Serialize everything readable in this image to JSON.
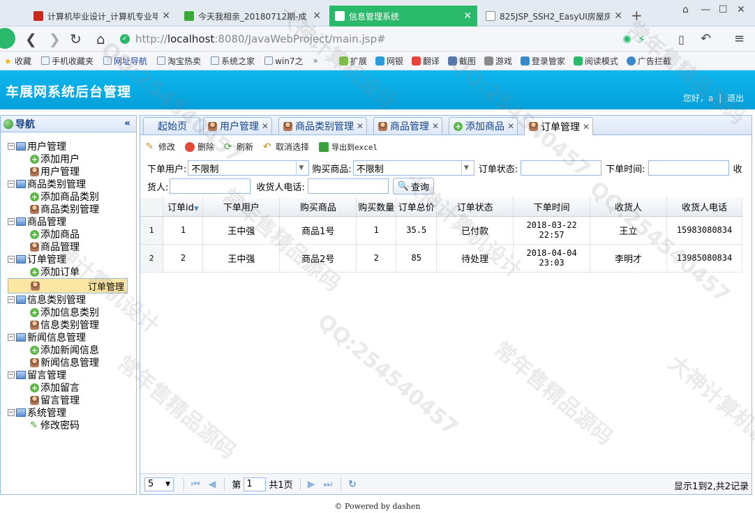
{
  "browser": {
    "tabs": [
      {
        "title": "计算机毕业设计_计算机专业毕"
      },
      {
        "title": "今天我相亲_20180712期-成"
      },
      {
        "title": "信息管理系统"
      },
      {
        "title": "825JSP_SSH2_EasyUI房屋房"
      }
    ],
    "url_prefix": "http://",
    "url_host": "localhost",
    "url_rest": ":8080/JavaWebProject/main.jsp#",
    "favorites": [
      "收藏",
      "手机收藏夹",
      "网址导航",
      "淘宝热卖",
      "系统之家",
      "win7之"
    ],
    "tools": [
      "扩展",
      "网银",
      "翻译",
      "截图",
      "游戏",
      "登录管家",
      "阅读模式",
      "广告拦截"
    ]
  },
  "header": {
    "title": "车展网系统后台管理",
    "greeting": "您好，a",
    "separator": "|",
    "logout": "退出"
  },
  "nav": {
    "title": "导航",
    "groups": [
      {
        "label": "用户管理",
        "items": [
          {
            "label": "添加用户",
            "icon": "add-icon"
          },
          {
            "label": "用户管理",
            "icon": "user-icon"
          }
        ]
      },
      {
        "label": "商品类别管理",
        "items": [
          {
            "label": "添加商品类别",
            "icon": "add-icon"
          },
          {
            "label": "商品类别管理",
            "icon": "user-icon"
          }
        ]
      },
      {
        "label": "商品管理",
        "items": [
          {
            "label": "添加商品",
            "icon": "add-icon"
          },
          {
            "label": "商品管理",
            "icon": "user-icon"
          }
        ]
      },
      {
        "label": "订单管理",
        "items": [
          {
            "label": "添加订单",
            "icon": "add-icon"
          },
          {
            "label": "订单管理",
            "icon": "user-icon"
          }
        ]
      },
      {
        "label": "信息类别管理",
        "items": [
          {
            "label": "添加信息类别",
            "icon": "add-icon"
          },
          {
            "label": "信息类别管理",
            "icon": "user-icon"
          }
        ]
      },
      {
        "label": "新闻信息管理",
        "items": [
          {
            "label": "添加新闻信息",
            "icon": "add-icon"
          },
          {
            "label": "新闻信息管理",
            "icon": "user-icon"
          }
        ]
      },
      {
        "label": "留言管理",
        "items": [
          {
            "label": "添加留言",
            "icon": "add-icon"
          },
          {
            "label": "留言管理",
            "icon": "user-icon"
          }
        ]
      },
      {
        "label": "系统管理",
        "items": [
          {
            "label": "修改密码",
            "icon": "pencil-icon"
          }
        ]
      }
    ]
  },
  "tabs": [
    {
      "label": "起始页",
      "closable": false
    },
    {
      "label": "用户管理",
      "closable": true
    },
    {
      "label": "商品类别管理",
      "closable": true
    },
    {
      "label": "商品管理",
      "closable": true
    },
    {
      "label": "添加商品",
      "closable": true
    },
    {
      "label": "订单管理",
      "closable": true
    }
  ],
  "toolbar": {
    "edit": "修改",
    "delete": "删除",
    "refresh": "刷新",
    "unselect": "取消选择",
    "export": "导出到excel"
  },
  "search": {
    "user_label": "下单用户:",
    "user_value": "不限制",
    "product_label": "购买商品:",
    "product_value": "不限制",
    "status_label": "订单状态:",
    "time_label": "下单时间:",
    "receiver_label_part1": "收",
    "receiver_label_part2": "货人:",
    "phone_label": "收货人电话:",
    "query_button": "查询"
  },
  "grid": {
    "columns": [
      "订单id",
      "下单用户",
      "购买商品",
      "购买数量",
      "订单总价",
      "订单状态",
      "下单时间",
      "收货人",
      "收货人电话"
    ],
    "rows": [
      {
        "rownum": "1",
        "cells": [
          "1",
          "王中强",
          "商品1号",
          "1",
          "35.5",
          "已付款",
          "2018-03-22 22:57",
          "王立",
          "15983080834"
        ]
      },
      {
        "rownum": "2",
        "cells": [
          "2",
          "王中强",
          "商品2号",
          "2",
          "85",
          "待处理",
          "2018-04-04 23:03",
          "李明才",
          "13985080834"
        ]
      }
    ]
  },
  "pager": {
    "page_size": "5",
    "page_label_pre": "第",
    "page_value": "1",
    "page_label_post": "共1页",
    "info": "显示1到2,共2记录"
  },
  "footer": "© Powered by dashen",
  "watermark": [
    "大神计算机设计",
    "QQ:254540457",
    "常年售精品源码"
  ],
  "colors": {
    "header_bg": "#059fd9",
    "accent_green": "#2ab86a",
    "panel_border": "#99bbe8",
    "selected_row": "#fbe6a2"
  }
}
